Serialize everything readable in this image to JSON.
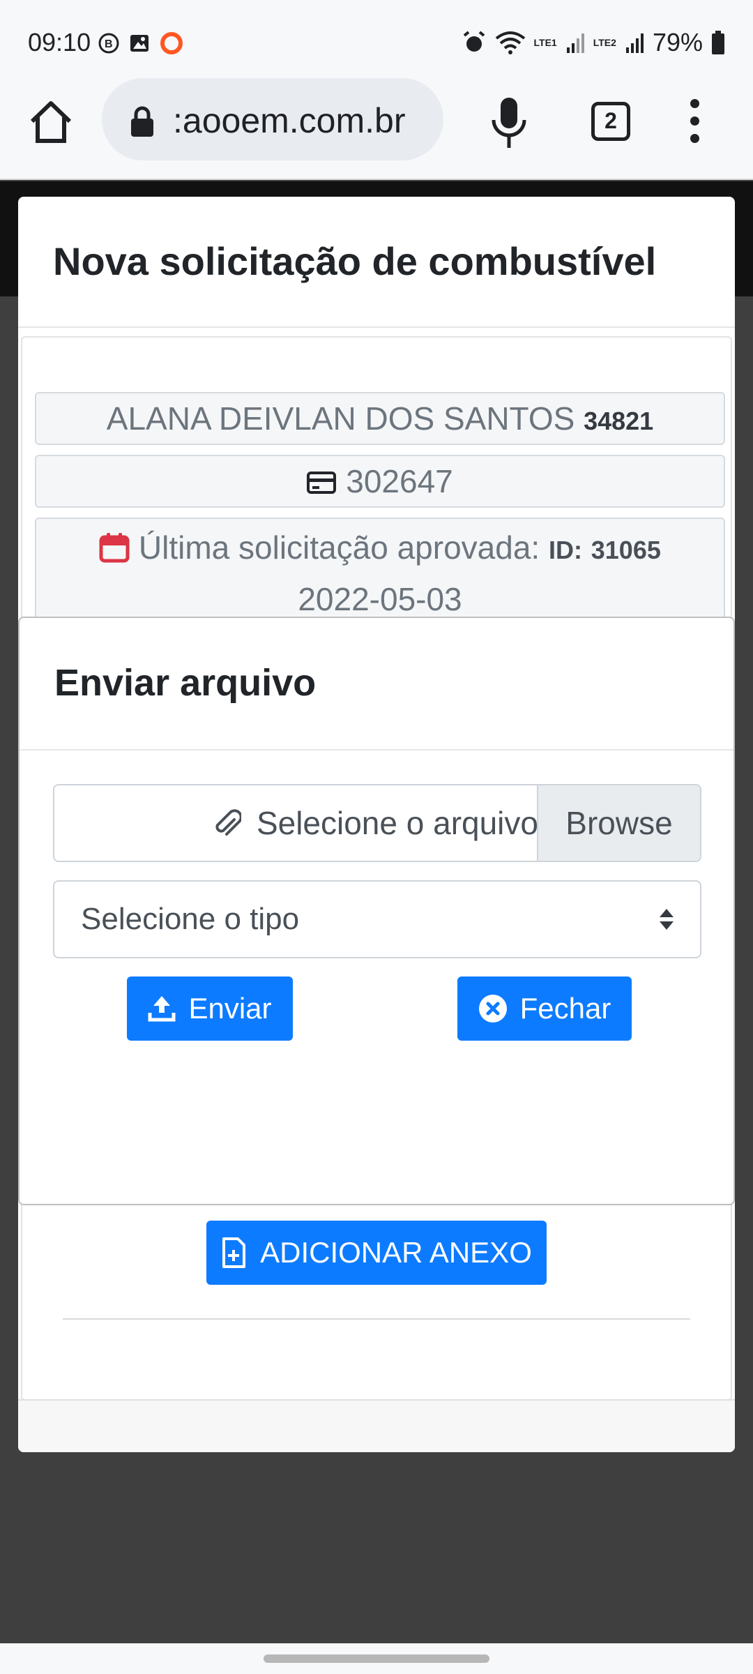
{
  "status_bar": {
    "time": "09:10",
    "battery": "79%",
    "sim1": "LTE1",
    "sim2": "LTE2"
  },
  "browser": {
    "url": ":aooem.com.br",
    "tab_count": "2"
  },
  "page": {
    "title": "Nova solicitação de combustível",
    "driver_name": "ALANA DEIVLAN DOS SANTOS",
    "driver_id": "34821",
    "card_number": "302647",
    "last_request_label": "Última solicitação aprovada:",
    "last_request_id_label": "ID:",
    "last_request_id": "31065",
    "last_request_date": "2022-05-03",
    "add_attachment_label": "ADICIONAR ANEXO"
  },
  "modal": {
    "title": "Enviar arquivo",
    "file_placeholder": "Selecione o arquivo",
    "browse_label": "Browse",
    "type_placeholder": "Selecione o tipo",
    "send_label": "Enviar",
    "close_label": "Fechar"
  },
  "colors": {
    "primary": "#0d7bff",
    "calendar_icon": "#dc3545"
  }
}
